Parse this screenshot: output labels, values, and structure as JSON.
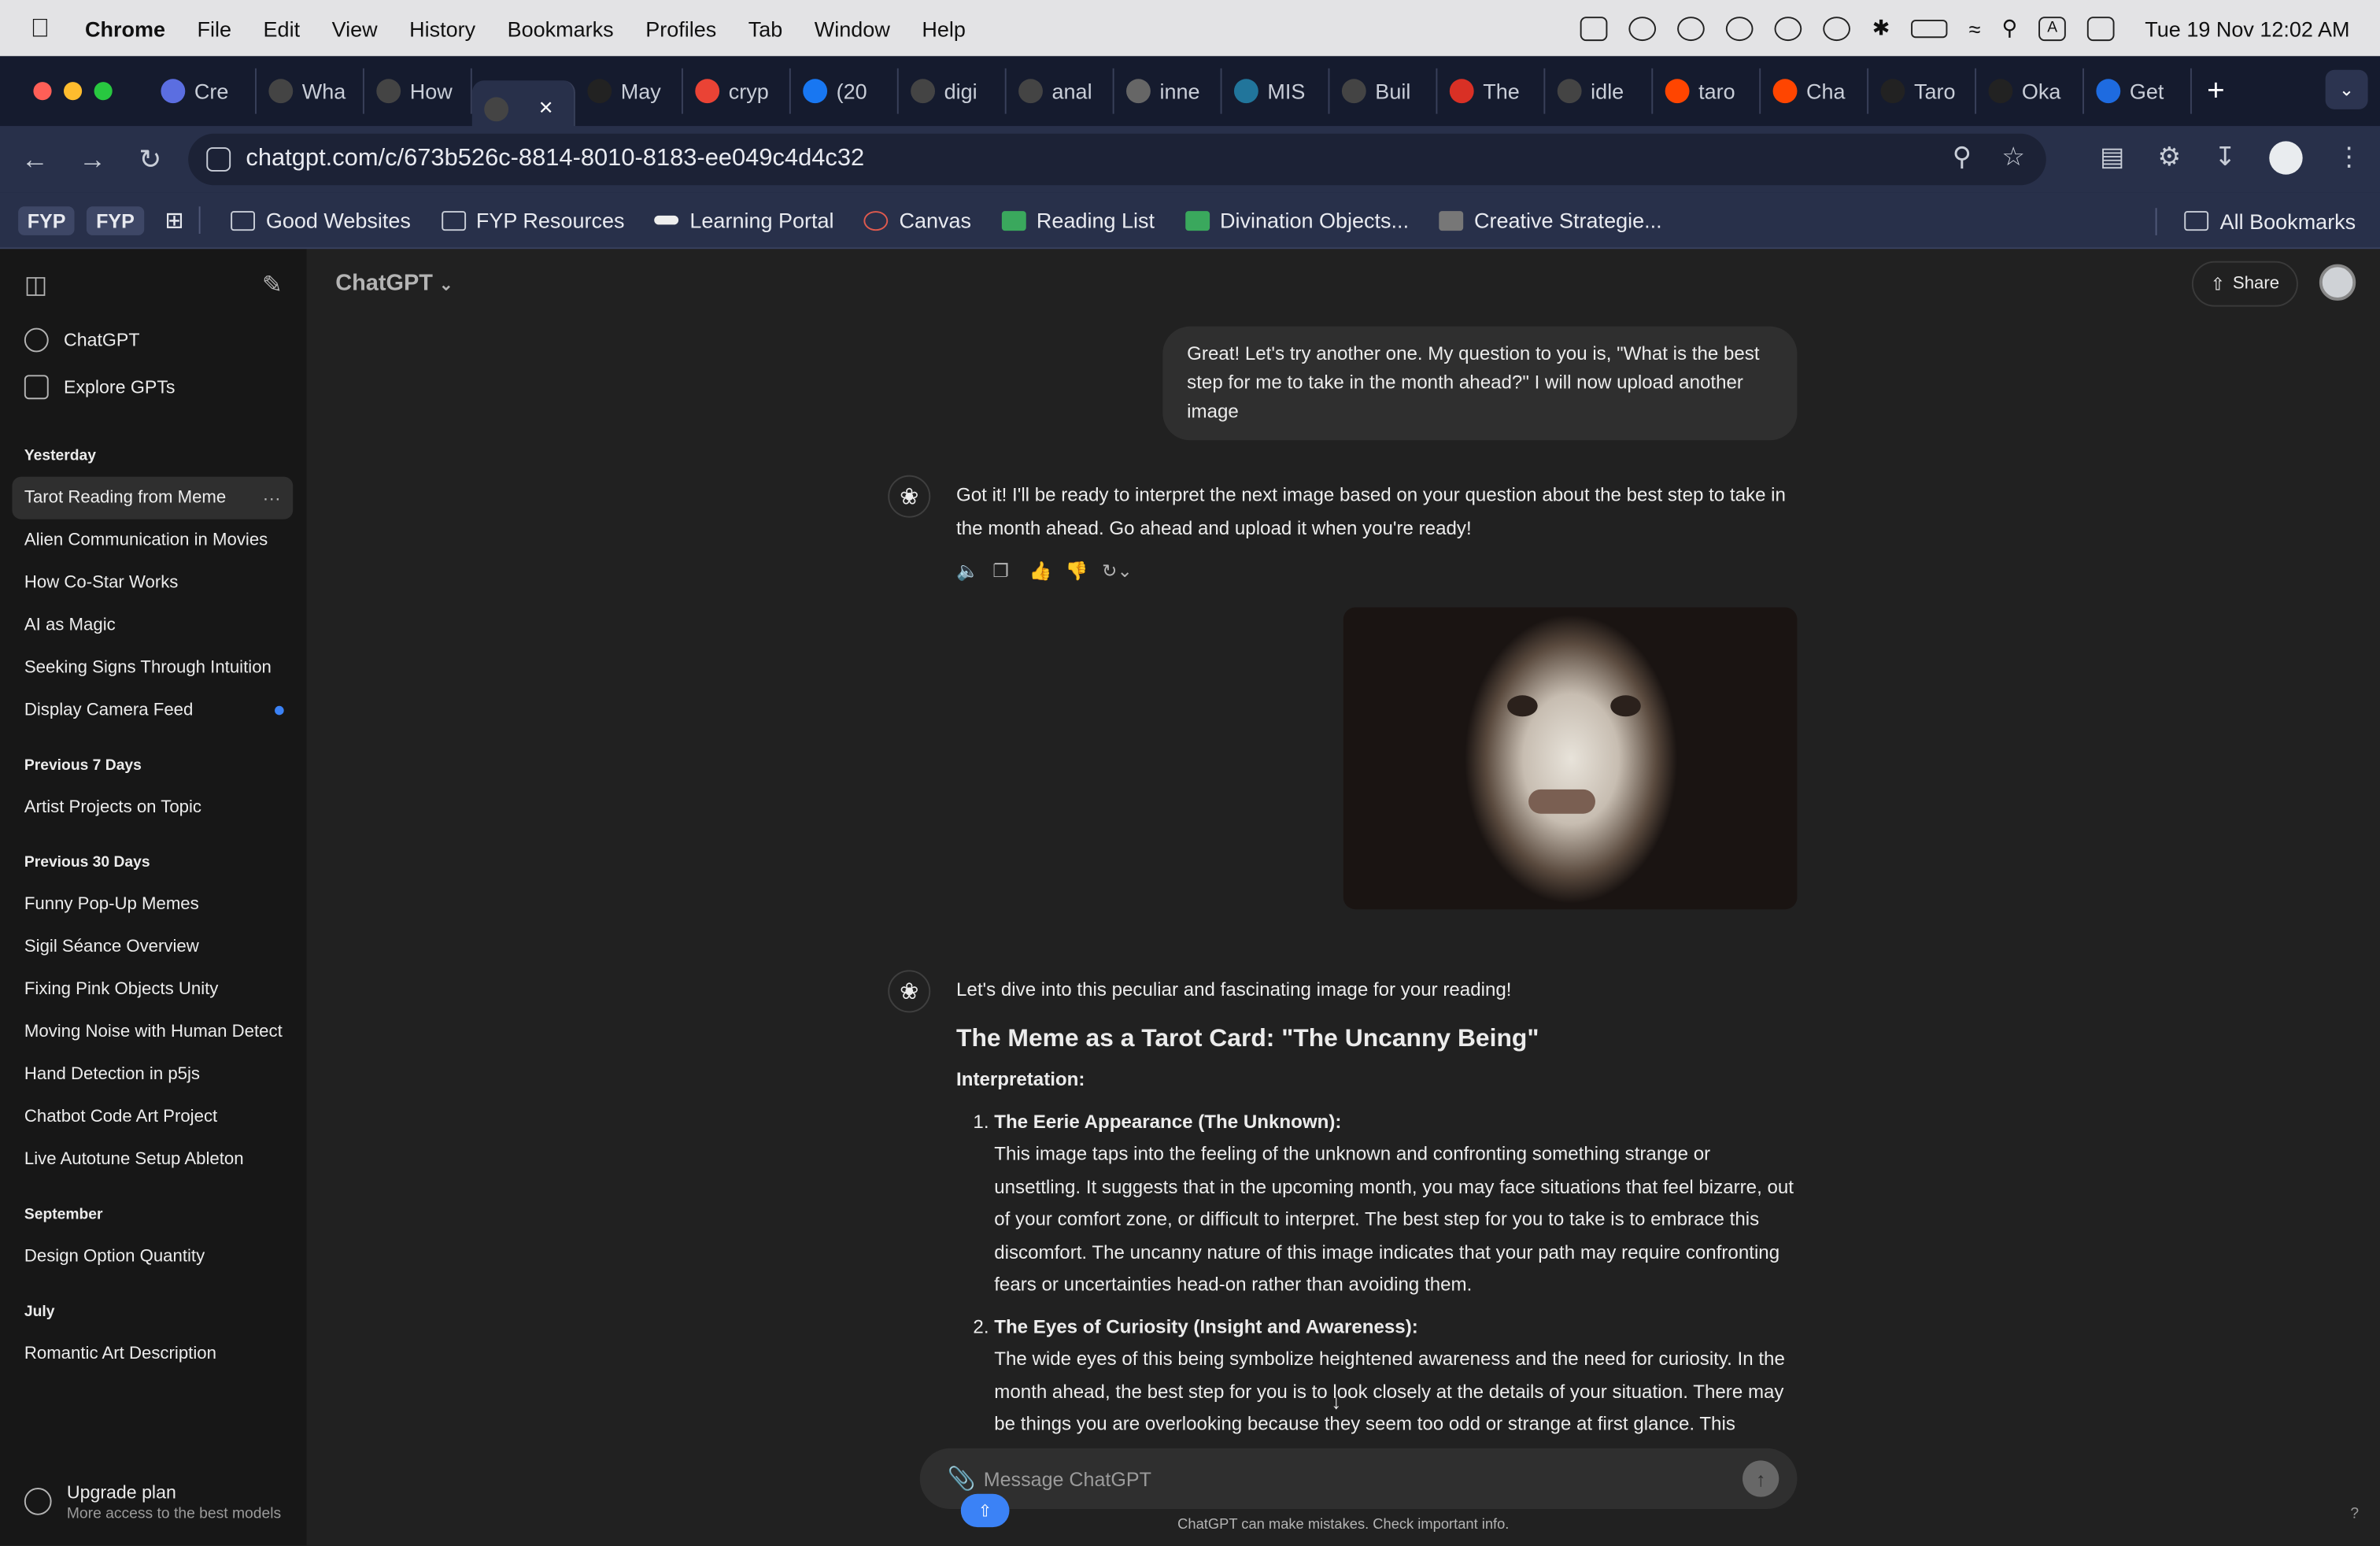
{
  "menubar": {
    "app": "Chrome",
    "items": [
      "File",
      "Edit",
      "View",
      "History",
      "Bookmarks",
      "Profiles",
      "Tab",
      "Window",
      "Help"
    ],
    "clock": "Tue 19 Nov  12:02 AM"
  },
  "tabs": [
    {
      "label": "Cre",
      "color": "#5b6ee1"
    },
    {
      "label": "Wha",
      "color": "#444"
    },
    {
      "label": "How",
      "color": "#444"
    },
    {
      "label": "",
      "color": "#444",
      "active": true
    },
    {
      "label": "May",
      "color": "#222"
    },
    {
      "label": "cryp",
      "color": "#ea4335"
    },
    {
      "label": "(20",
      "color": "#1877f2"
    },
    {
      "label": "digi",
      "color": "#444"
    },
    {
      "label": "anal",
      "color": "#444"
    },
    {
      "label": "inne",
      "color": "#666"
    },
    {
      "label": "MIS",
      "color": "#21759b"
    },
    {
      "label": "Buil",
      "color": "#444"
    },
    {
      "label": "The",
      "color": "#d93025"
    },
    {
      "label": "idle",
      "color": "#444"
    },
    {
      "label": "taro",
      "color": "#ff4500"
    },
    {
      "label": "Cha",
      "color": "#ff4500"
    },
    {
      "label": "Taro",
      "color": "#222"
    },
    {
      "label": "Oka",
      "color": "#222"
    },
    {
      "label": "Get",
      "color": "#1e6be0"
    }
  ],
  "address": {
    "url": "chatgpt.com/c/673b526c-8814-8010-8183-ee049c4d4c32"
  },
  "bookmarks": {
    "chips": [
      "FYP",
      "FYP"
    ],
    "items": [
      {
        "label": "Good Websites",
        "icon": "folder"
      },
      {
        "label": "FYP Resources",
        "icon": "folder"
      },
      {
        "label": "Learning Portal",
        "icon": "bird"
      },
      {
        "label": "Canvas",
        "icon": "red"
      },
      {
        "label": "Reading List",
        "icon": "green"
      },
      {
        "label": "Divination Objects...",
        "icon": "green"
      },
      {
        "label": "Creative Strategie...",
        "icon": "grey"
      }
    ],
    "all": "All Bookmarks"
  },
  "sidebar": {
    "links": [
      {
        "label": "ChatGPT"
      },
      {
        "label": "Explore GPTs"
      }
    ],
    "sections": [
      {
        "title": "Yesterday",
        "items": [
          "Tarot Reading from Meme",
          "Alien Communication in Movies",
          "How Co-Star Works",
          "AI as Magic",
          "Seeking Signs Through Intuition",
          "Display Camera Feed"
        ]
      },
      {
        "title": "Previous 7 Days",
        "items": [
          "Artist Projects on Topic"
        ]
      },
      {
        "title": "Previous 30 Days",
        "items": [
          "Funny Pop-Up Memes",
          "Sigil Séance Overview",
          "Fixing Pink Objects Unity",
          "Moving Noise with Human Detect",
          "Hand Detection in p5js",
          "Chatbot Code Art Project",
          "Live Autotune Setup Ableton"
        ]
      },
      {
        "title": "September",
        "items": [
          "Design Option Quantity"
        ]
      },
      {
        "title": "July",
        "items": [
          "Romantic Art Description"
        ]
      }
    ],
    "upgrade_title": "Upgrade plan",
    "upgrade_sub": "More access to the best models"
  },
  "main": {
    "model": "ChatGPT",
    "share": "Share",
    "user_message": "Great! Let's try another one. My question to you is, \"What is the best step for me to take in the month ahead?\" I will now upload another image",
    "reply1": "Got it! I'll be ready to interpret the next image based on your question about the best step to take in the month ahead. Go ahead and upload it when you're ready!",
    "reply2_intro": "Let's dive into this peculiar and fascinating image for your reading!",
    "reply2_heading": "The Meme as a Tarot Card: \"The Uncanny Being\"",
    "reply2_label": "Interpretation:",
    "points": [
      {
        "title": "The Eerie Appearance (The Unknown):",
        "text": "This image taps into the feeling of the unknown and confronting something strange or unsettling. It suggests that in the upcoming month, you may face situations that feel bizarre, out of your comfort zone, or difficult to interpret. The best step for you to take is to embrace this discomfort. The uncanny nature of this image indicates that your path may require confronting fears or uncertainties head-on rather than avoiding them."
      },
      {
        "title": "The Eyes of Curiosity (Insight and Awareness):",
        "text": "The wide eyes of this being symbolize heightened awareness and the need for curiosity. In the month ahead, the best step for you is to look closely at the details of your situation. There may be things you are overlooking because they seem too odd or strange at first glance. This"
      }
    ],
    "composer_placeholder": "Message ChatGPT",
    "disclaimer": "ChatGPT can make mistakes. Check important info.",
    "help": "?"
  }
}
